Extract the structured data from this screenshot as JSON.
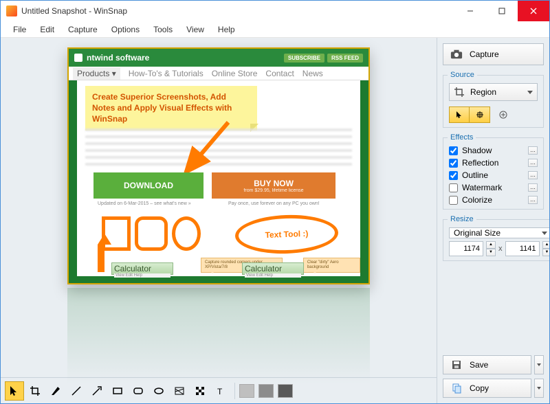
{
  "titlebar": {
    "title": "Untitled Snapshot - WinSnap"
  },
  "menu": {
    "items": [
      "File",
      "Edit",
      "Capture",
      "Options",
      "Tools",
      "View",
      "Help"
    ]
  },
  "screenshot": {
    "site_name": "ntwind software",
    "pill_subscribe": "SUBSCRIBE",
    "pill_rss": "RSS FEED",
    "nav": [
      "Products ▾",
      "How-To's & Tutorials",
      "Online Store",
      "Contact",
      "News"
    ],
    "hero_text": "Create Superior Screenshots, Add Notes and Apply Visual Effects with WinSnap",
    "download_label": "DOWNLOAD",
    "buy_label": "BUY NOW",
    "buy_sub": "from $29.95, lifetime license",
    "updated_text": "Updated on 6-Mar-2015 – see what's new »",
    "pay_text": "Pay once, use forever on any PC you own!",
    "text_tool_label": "Text Tool :)",
    "callout1": "Capture rounded corners under XP/Vista/7/8",
    "callout2": "Clear \"dirty\" Aero background",
    "mini_title": "Calculator",
    "mini_menu": "View   Edit   Help"
  },
  "side": {
    "capture_label": "Capture",
    "source": {
      "legend": "Source",
      "value": "Region"
    },
    "effects": {
      "legend": "Effects",
      "items": [
        {
          "label": "Shadow",
          "checked": true
        },
        {
          "label": "Reflection",
          "checked": true
        },
        {
          "label": "Outline",
          "checked": true
        },
        {
          "label": "Watermark",
          "checked": false
        },
        {
          "label": "Colorize",
          "checked": false
        }
      ]
    },
    "resize": {
      "legend": "Resize",
      "value": "Original Size",
      "w": "1174",
      "h": "1141",
      "x": "x"
    },
    "save_label": "Save",
    "copy_label": "Copy"
  },
  "toolbar": {
    "swatches": [
      "#bfbfbf",
      "#8c8c8c",
      "#595959"
    ]
  }
}
